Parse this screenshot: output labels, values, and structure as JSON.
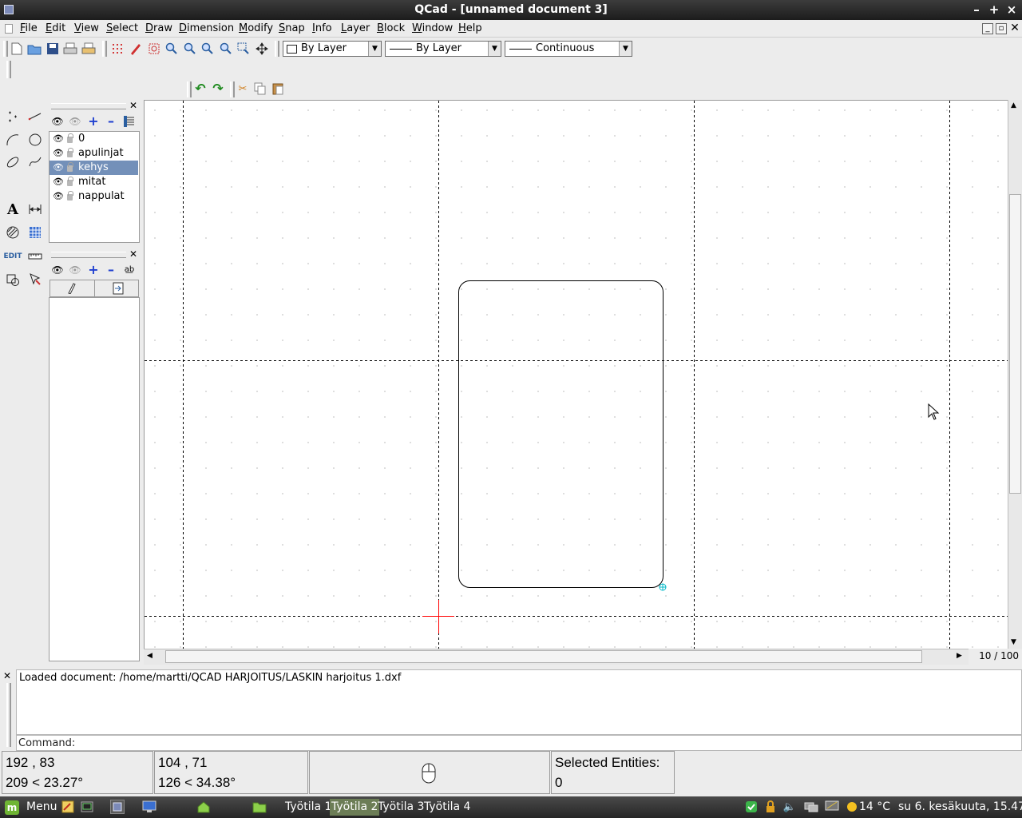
{
  "window": {
    "title": "QCad - [unnamed document 3]"
  },
  "menu": {
    "items": [
      "File",
      "Edit",
      "View",
      "Select",
      "Draw",
      "Dimension",
      "Modify",
      "Snap",
      "Info",
      "Layer",
      "Block",
      "Window",
      "Help"
    ]
  },
  "toolbar": {
    "color_combo": "By Layer",
    "width_combo": "By Layer",
    "linetype_combo": "Continuous"
  },
  "layers": {
    "items": [
      {
        "name": "0",
        "selected": false
      },
      {
        "name": "apulinjat",
        "selected": false
      },
      {
        "name": "kehys",
        "selected": true
      },
      {
        "name": "mitat",
        "selected": false
      },
      {
        "name": "nappulat",
        "selected": false
      }
    ]
  },
  "canvas": {
    "grid_label": "10 / 100"
  },
  "history": {
    "lines": [
      "Loaded document: /home/martti/QCAD HARJOITUS/LASKIN harjoitus 1.dxf"
    ]
  },
  "command": {
    "label": "Command:"
  },
  "status": {
    "abs_coord": "192 , 83",
    "abs_polar": "209 < 23.27°",
    "rel_coord": "104 , 71",
    "rel_polar": "126 < 34.38°",
    "selected_label": "Selected Entities:",
    "selected_count": "0"
  },
  "taskbar": {
    "menu_label": "Menu",
    "workspaces": [
      {
        "label": "Työtila 1",
        "active": false
      },
      {
        "label": "Työtila 2",
        "active": true
      },
      {
        "label": "Työtila 3",
        "active": false
      },
      {
        "label": "Työtila 4",
        "active": false
      }
    ],
    "temperature": "14 °C",
    "datetime": "su  6. kesäkuuta, 15.47"
  },
  "colors": {
    "selection": "#7390b9",
    "crosshair": "#ff0000",
    "snap_marker": "#00b8c8"
  }
}
